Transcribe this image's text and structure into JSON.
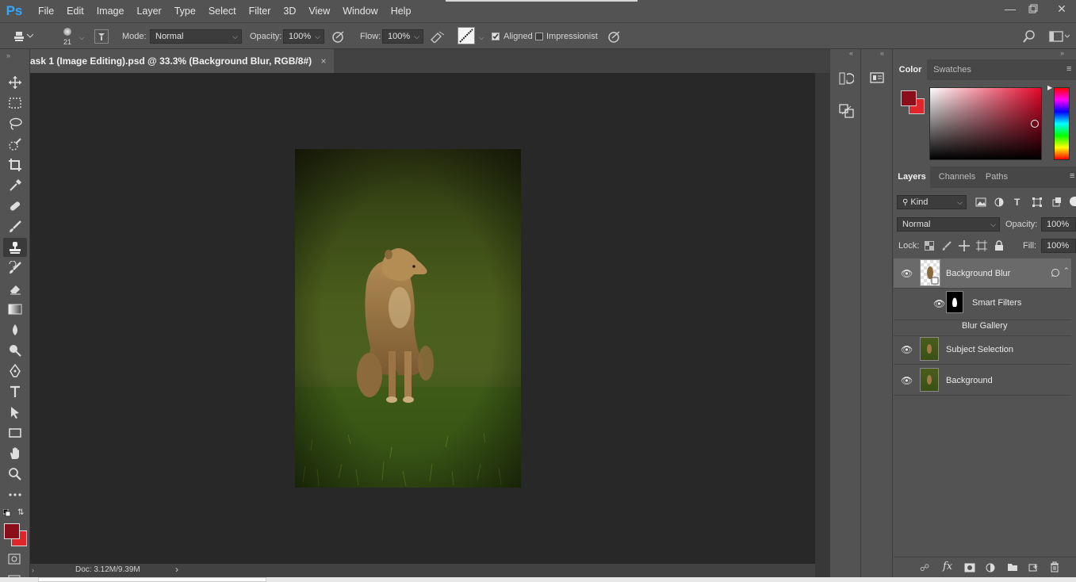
{
  "app": {
    "logo": "Ps"
  },
  "menu": [
    "File",
    "Edit",
    "Image",
    "Layer",
    "Type",
    "Select",
    "Filter",
    "3D",
    "View",
    "Window",
    "Help"
  ],
  "options": {
    "brush_size": "21",
    "mode_label": "Mode:",
    "mode_value": "Normal",
    "opacity_label": "Opacity:",
    "opacity_value": "100%",
    "flow_label": "Flow:",
    "flow_value": "100%",
    "aligned_label": "Aligned",
    "aligned_checked": true,
    "impressionist_label": "Impressionist",
    "impressionist_checked": false
  },
  "document": {
    "tab_title": "ask 1 (Image Editing).psd @ 33.3% (Background Blur, RGB/8#)",
    "close": "×",
    "status": "Doc: 3.12M/9.39M"
  },
  "color_panel": {
    "tabs": [
      "Color",
      "Swatches"
    ],
    "foreground": "#8b0f1a",
    "background": "#e0262b"
  },
  "layers_panel": {
    "tabs": [
      "Layers",
      "Channels",
      "Paths"
    ],
    "kind_label": "Kind",
    "blend_mode": "Normal",
    "opacity_label": "Opacity:",
    "opacity_value": "100%",
    "lock_label": "Lock:",
    "fill_label": "Fill:",
    "fill_value": "100%",
    "layers": [
      {
        "name": "Background Blur",
        "selected": true
      },
      {
        "name": "Smart Filters"
      },
      {
        "name": "Blur Gallery"
      },
      {
        "name": "Subject Selection"
      },
      {
        "name": "Background"
      }
    ]
  }
}
